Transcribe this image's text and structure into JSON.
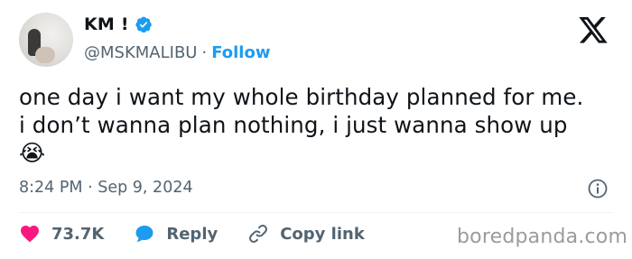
{
  "tweet": {
    "author": {
      "name": "KM !",
      "handle": "@MSKMALIBU",
      "separator": "·",
      "follow_label": "Follow",
      "verified": true
    },
    "text_lines": [
      "one day i want my whole birthday planned for me.",
      "i don’t wanna plan nothing, i just wanna show up"
    ],
    "emoji": "😭",
    "time": "8:24 PM",
    "date_separator": "·",
    "date": "Sep 9, 2024",
    "actions": {
      "likes": "73.7K",
      "reply_label": "Reply",
      "copy_link_label": "Copy link"
    }
  },
  "watermark": "boredpanda.com",
  "colors": {
    "text": "#0f1419",
    "muted": "#536471",
    "accent": "#1d9bf0",
    "heart": "#f91880",
    "watermark": "#9b9b9b"
  },
  "icons": [
    "verified-badge-icon",
    "x-logo-icon",
    "info-icon",
    "heart-icon",
    "reply-bubble-icon",
    "link-icon"
  ]
}
